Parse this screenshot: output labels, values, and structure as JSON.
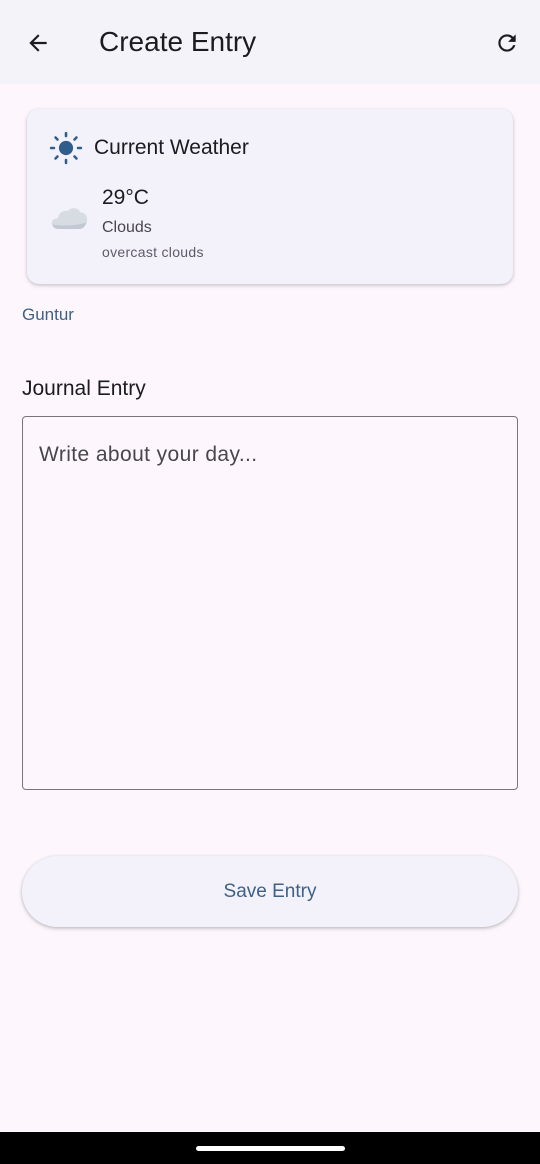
{
  "appbar": {
    "title": "Create Entry",
    "back_icon": "arrow-back-icon",
    "refresh_icon": "refresh-icon"
  },
  "weather": {
    "title": "Current Weather",
    "temperature": "29°C",
    "condition": "Clouds",
    "description": "overcast clouds",
    "title_icon": "sun-icon",
    "condition_icon": "cloud-icon"
  },
  "location": "Guntur",
  "journal": {
    "label": "Journal Entry",
    "placeholder": "Write about your day...",
    "value": ""
  },
  "save_button": {
    "label": "Save Entry"
  },
  "colors": {
    "background": "#fdf7fd",
    "appbar": "#f4f3fa",
    "card": "#f3f1f9",
    "accent": "#3f6186",
    "sun": "#2f5d8c"
  }
}
